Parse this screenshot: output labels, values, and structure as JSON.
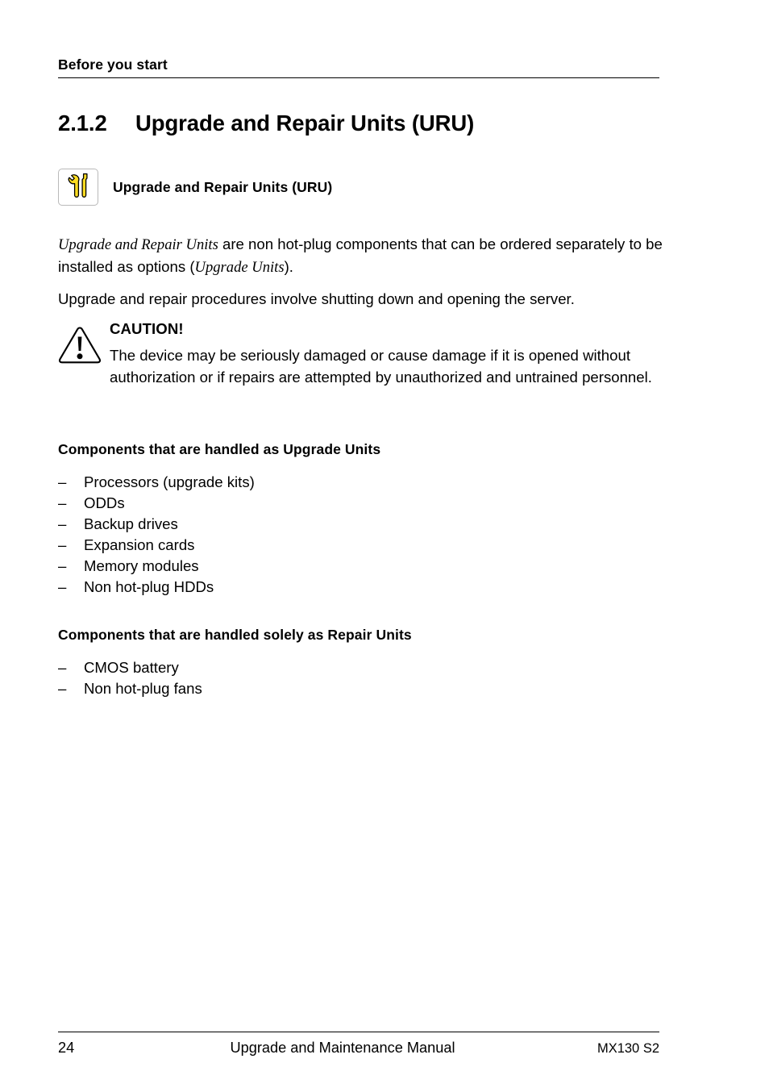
{
  "header": {
    "running_title": "Before you start"
  },
  "section": {
    "number": "2.1.2",
    "title": "Upgrade and Repair Units (URU)"
  },
  "note": {
    "icon": "wrench-screwdriver-icon",
    "label": "Upgrade and Repair Units (URU)",
    "icon_color": "#FFDD22",
    "icon_border_color": "#b9b9b9"
  },
  "paragraphs": {
    "p1_italic_lead": "Upgrade and Repair Units",
    "p1_rest": " are non hot-plug components that can be ordered separately to be installed as options (",
    "p1_italic_tail": "Upgrade Units",
    "p1_end": ").",
    "p2": "Upgrade and repair procedures involve shutting down and opening the server."
  },
  "caution": {
    "icon": "warning-triangle-icon",
    "title": "CAUTION!",
    "text": "The device may be seriously damaged or cause damage if it is opened without authorization or if repairs are attempted by unauthorized and untrained personnel."
  },
  "lists": [
    {
      "heading": "Components that are handled as Upgrade Units",
      "bullet": "–",
      "items": [
        "Processors (upgrade kits)",
        "ODDs",
        "Backup drives",
        "Expansion cards",
        "Memory modules",
        "Non hot-plug HDDs"
      ]
    },
    {
      "heading": "Components that are handled solely as Repair Units",
      "bullet": "–",
      "items": [
        "CMOS battery",
        "Non hot-plug fans"
      ]
    }
  ],
  "footer": {
    "page_number": "24",
    "document_title": "Upgrade and Maintenance Manual",
    "product": "MX130 S2"
  }
}
